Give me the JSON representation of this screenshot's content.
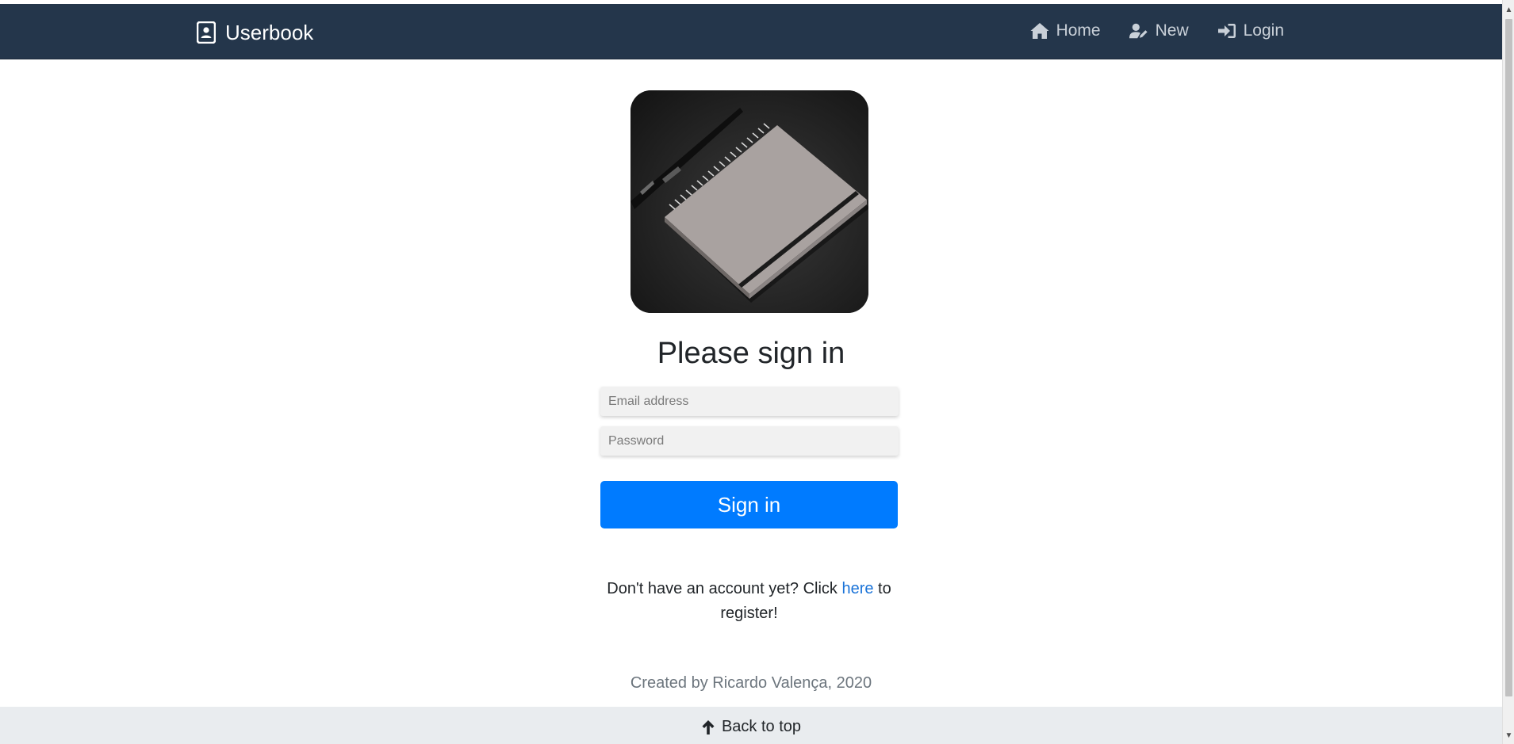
{
  "navbar": {
    "brand": "Userbook",
    "items": [
      {
        "label": "Home",
        "icon": "home-icon"
      },
      {
        "label": "New",
        "icon": "user-edit-icon"
      },
      {
        "label": "Login",
        "icon": "sign-in-icon"
      }
    ]
  },
  "hero": {
    "alt": "notebook and pen photo"
  },
  "form": {
    "title": "Please sign in",
    "email_placeholder": "Email address",
    "password_placeholder": "Password",
    "submit_label": "Sign in"
  },
  "register": {
    "prefix": "Don't have an account yet? Click ",
    "link": "here",
    "suffix": " to register!"
  },
  "footer": {
    "credit": "Created by Ricardo Valença, 2020",
    "back_to_top": "Back to top"
  },
  "colors": {
    "navbar": "#24364b",
    "primary": "#007bff",
    "footer": "#e9ecef"
  }
}
